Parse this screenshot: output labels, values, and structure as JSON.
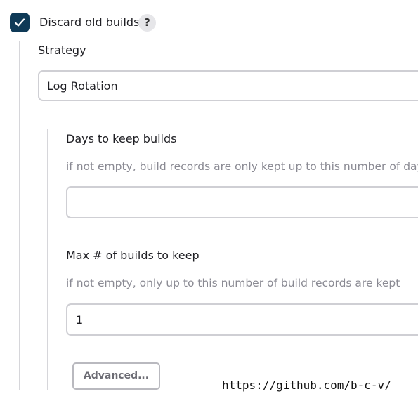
{
  "discard_old_builds": {
    "label": "Discard old builds",
    "checked": true,
    "help_label": "?"
  },
  "strategy": {
    "label": "Strategy",
    "selected": "Log Rotation"
  },
  "days_to_keep": {
    "label": "Days to keep builds",
    "help": "if not empty, build records are only kept up to this number of days",
    "value": ""
  },
  "max_builds": {
    "label": "Max # of builds to keep",
    "help": "if not empty, only up to this number of build records are kept",
    "value": "1"
  },
  "advanced_button": {
    "label": "Advanced..."
  },
  "watermark": "https://github.com/b-c-v/",
  "colors": {
    "checkbox_fill": "#0f3a57",
    "help_text": "#8a8a93",
    "border": "#cfcfd4"
  },
  "icons": {
    "checkbox": "checkmark-icon",
    "help": "question-mark-icon"
  }
}
